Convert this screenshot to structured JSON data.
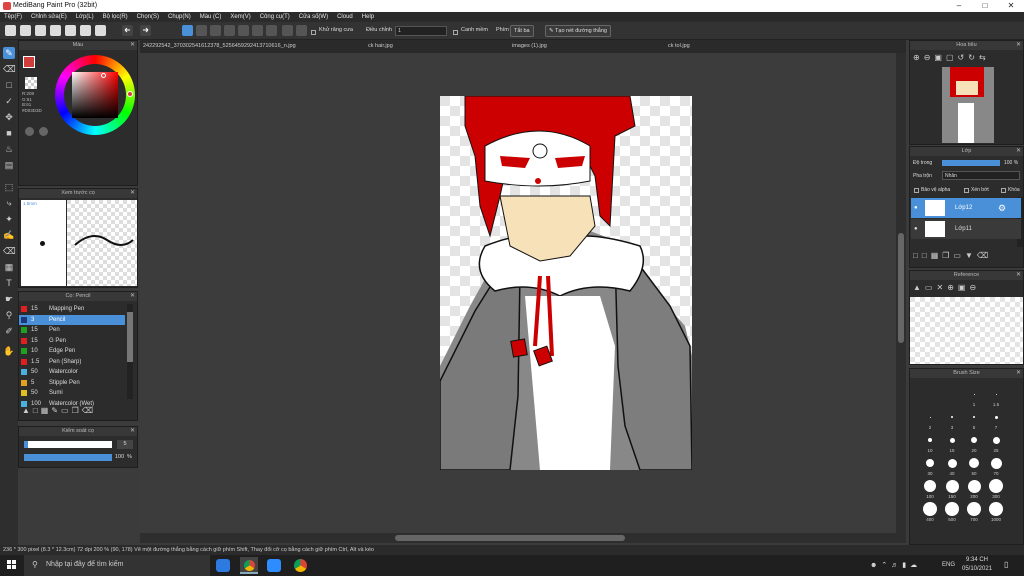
{
  "app": {
    "title": "MediBang Paint Pro (32bit)"
  },
  "menu": [
    "Tệp(F)",
    "Chỉnh sửa(E)",
    "Lớp(L)",
    "Bộ lọc(R)",
    "Chọn(S)",
    "Chụp(N)",
    "Màu (C)",
    "Xem(V)",
    "Công cụ(T)",
    "Cửa số(W)",
    "Cloud",
    "Help"
  ],
  "toolbar": {
    "antialias_label": "Khử răng cưa",
    "correction_label": "Điều chỉnh",
    "correction_value": "1",
    "snap_label": "Canh mềm",
    "snap_sublabel": "Phím",
    "snap_off_label": "Tắt ba",
    "straight_line_label": "Tạo nét đường thẳng"
  },
  "tabs": [
    "242292542_370302541612378_5256459292413710616_n.jpg",
    "ck hair.jpg",
    "images (1).jpg",
    "ck tol.jpg"
  ],
  "color_panel": {
    "title": "Màu",
    "r": "R:208",
    "g": "G:61",
    "b": "B:61",
    "hex": "#D03D3D",
    "fg_color": "#d03d3d"
  },
  "brush_preview": {
    "title": "Xem trước cọ",
    "size": "1.5mm"
  },
  "brush_list": {
    "title": "Cọ: Pencil",
    "items": [
      {
        "size": "15",
        "name": "Mapping Pen",
        "color": "#e02020"
      },
      {
        "size": "3",
        "name": "Pencil",
        "color": "#1a3a7a"
      },
      {
        "size": "15",
        "name": "Pen",
        "color": "#20a020"
      },
      {
        "size": "15",
        "name": "G Pen",
        "color": "#e02020"
      },
      {
        "size": "10",
        "name": "Edge Pen",
        "color": "#20a020"
      },
      {
        "size": "1.5",
        "name": "Pen (Sharp)",
        "color": "#e02020"
      },
      {
        "size": "50",
        "name": "Watercolor",
        "color": "#4ab0e0"
      },
      {
        "size": "5",
        "name": "Stipple Pen",
        "color": "#e0a020"
      },
      {
        "size": "50",
        "name": "Sumi",
        "color": "#e0c020"
      },
      {
        "size": "100",
        "name": "Watercolor (Wet)",
        "color": "#4ab0e0"
      }
    ]
  },
  "brush_control": {
    "title": "Kiểm soát cọ",
    "size": "5",
    "opacity": "100",
    "opacity_unit": "%"
  },
  "navigator": {
    "title": "Hoa tiêu"
  },
  "layers": {
    "title": "Lớp",
    "opacity_label": "Độ trong",
    "opacity_value": "100 %",
    "blend_label": "Pha trộn",
    "blend_value": "Nhân",
    "protect_alpha": "Bảo vệ alpha",
    "clipping": "Xén bớt",
    "lock": "Khóa",
    "items": [
      {
        "name": "Lớp12"
      },
      {
        "name": "Lớp11"
      }
    ]
  },
  "reference": {
    "title": "Reference"
  },
  "brush_size": {
    "title": "Brush Size",
    "labels": [
      "1",
      "1.5",
      "2",
      "3",
      "5",
      "7",
      "10",
      "15",
      "20",
      "25",
      "30",
      "40",
      "50",
      "70",
      "100",
      "150",
      "200",
      "300",
      "400",
      "500",
      "700",
      "1000"
    ]
  },
  "status": {
    "text": "236 * 300 pixel  (8.3 * 12.3cm)  72 dpi  200 %  (90, 178)  Vẽ một đường thẳng bằng cách giữ phím Shift, Thay đổi cỡ cọ bằng cách giữ phím Ctrl, Alt và kéo"
  },
  "taskbar": {
    "search_placeholder": "Nhập tại đây để tìm kiếm",
    "time": "9:34 CH",
    "date": "05/10/2021",
    "lang": "ENG"
  }
}
